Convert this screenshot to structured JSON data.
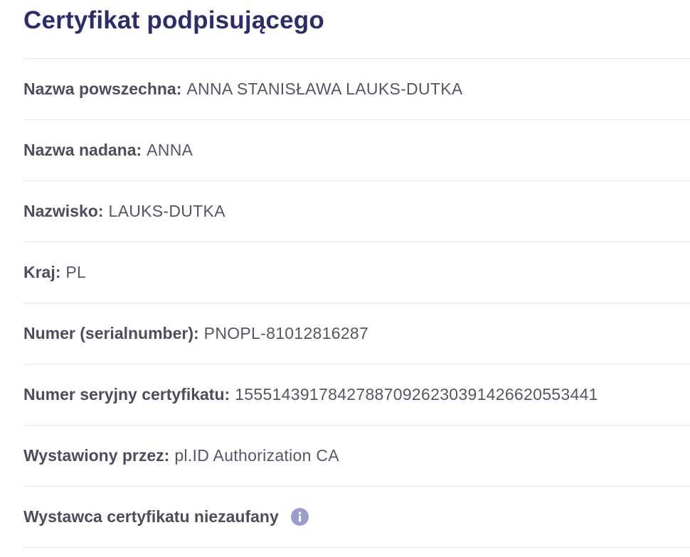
{
  "title": "Certyfikat podpisującego",
  "rows": [
    {
      "label": "Nazwa powszechna:",
      "value": "ANNA STANISŁAWA LAUKS-DUTKA"
    },
    {
      "label": "Nazwa nadana:",
      "value": "ANNA"
    },
    {
      "label": "Nazwisko:",
      "value": "LAUKS-DUTKA"
    },
    {
      "label": "Kraj:",
      "value": "PL"
    },
    {
      "label": "Numer (serialnumber):",
      "value": "PNOPL-81012816287"
    },
    {
      "label": "Numer seryjny certyfikatu:",
      "value": "155514391784278870926230391426620553441"
    },
    {
      "label": "Wystawiony przez:",
      "value": "pl.ID Authorization CA"
    }
  ],
  "warning": {
    "label": "Wystawca certyfikatu niezaufany",
    "icon": "info-icon",
    "icon_color": "#9b9bcc"
  },
  "colors": {
    "title": "#2d2d6b",
    "label": "#4d4d5e",
    "value": "#55556a",
    "divider": "#e6e6ea"
  }
}
